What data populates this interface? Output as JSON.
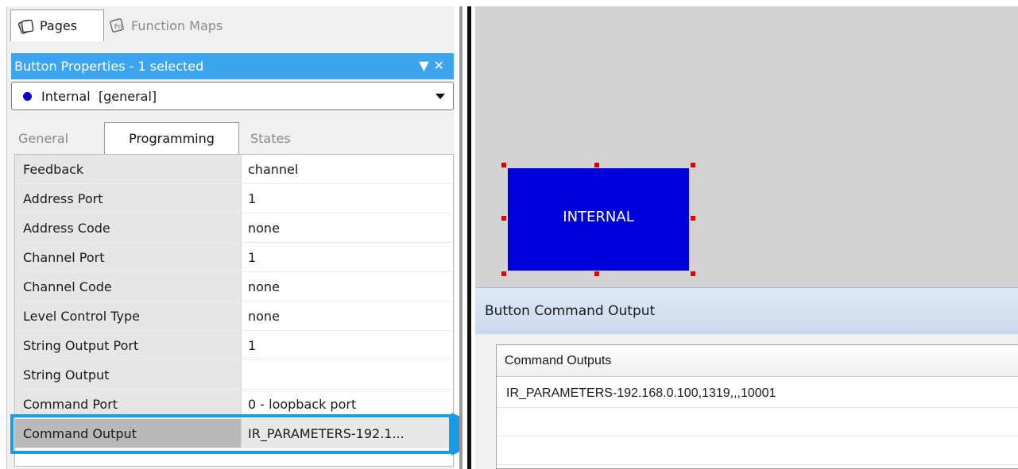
{
  "top_tabs": [
    {
      "label": "Pages",
      "icon": "pages-icon"
    },
    {
      "label": "Function Maps",
      "icon": "function-maps-icon"
    }
  ],
  "panel": {
    "title": "Button Properties - 1 selected",
    "selector_value": "Internal  [general]",
    "selector_dot_color": "#0a00c8"
  },
  "sub_tabs": [
    "General",
    "Programming",
    "States"
  ],
  "properties": [
    {
      "label": "Feedback",
      "value": "channel"
    },
    {
      "label": "Address Port",
      "value": "1"
    },
    {
      "label": "Address Code",
      "value": "none"
    },
    {
      "label": "Channel Port",
      "value": "1"
    },
    {
      "label": "Channel Code",
      "value": "none"
    },
    {
      "label": "Level Control Type",
      "value": "none"
    },
    {
      "label": "String Output Port",
      "value": "1"
    },
    {
      "label": "String Output",
      "value": ""
    },
    {
      "label": "Command Port",
      "value": "0 - loopback port"
    },
    {
      "label": "Command Output",
      "value": "IR_PARAMETERS-192.1..."
    }
  ],
  "canvas": {
    "button_label": "INTERNAL",
    "button_color": "#0000dd"
  },
  "dialog": {
    "title": "Button Command Output",
    "list_header": "Command Outputs",
    "rows": [
      "IR_PARAMETERS-192.168.0.100,1319,,,10001",
      "",
      ""
    ]
  },
  "colors": {
    "accent": "#3da4ee",
    "highlight_arrow": "#1a9be2",
    "selection_handle": "#e00000"
  }
}
